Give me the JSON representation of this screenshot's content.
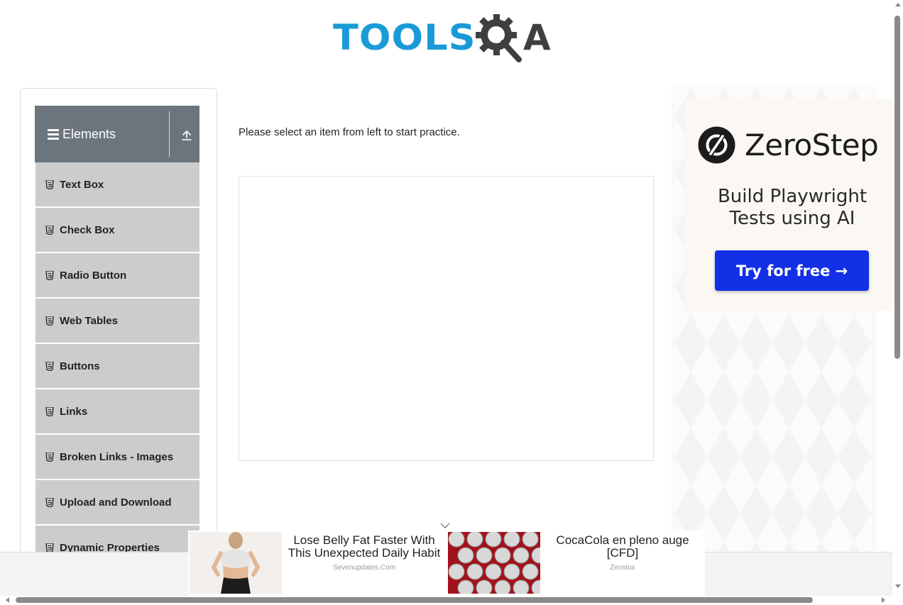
{
  "header": {
    "logo_left": "TOOLS",
    "logo_right": "A",
    "logo_colors": {
      "tools": "#1a9ad6",
      "qa": "#3f3f3f"
    }
  },
  "sidebar": {
    "group_title": "Elements",
    "header_color": "#6c757d",
    "item_color": "#cccccc",
    "items": [
      {
        "label": "Text Box"
      },
      {
        "label": "Check Box"
      },
      {
        "label": "Radio Button"
      },
      {
        "label": "Web Tables"
      },
      {
        "label": "Buttons"
      },
      {
        "label": "Links"
      },
      {
        "label": "Broken Links - Images"
      },
      {
        "label": "Upload and Download"
      },
      {
        "label": "Dynamic Properties"
      }
    ]
  },
  "main": {
    "intro_text": "Please select an item from left to start practice."
  },
  "side_ad": {
    "brand": "ZeroStep",
    "tagline_line1": "Build Playwright",
    "tagline_line2": "Tests using AI",
    "cta": "Try for free →",
    "cta_color": "#1330e6"
  },
  "bottom_ads": [
    {
      "headline": "Lose Belly Fat Faster With This Unexpected Daily Habit",
      "source": "Sevenupdates.Com",
      "thumb_icon": "fitness-woman-thumbnail"
    },
    {
      "headline": "CocaCola en pleno auge [CFD]",
      "source": "Zenstox",
      "thumb_icon": "soda-cans-thumbnail"
    }
  ]
}
